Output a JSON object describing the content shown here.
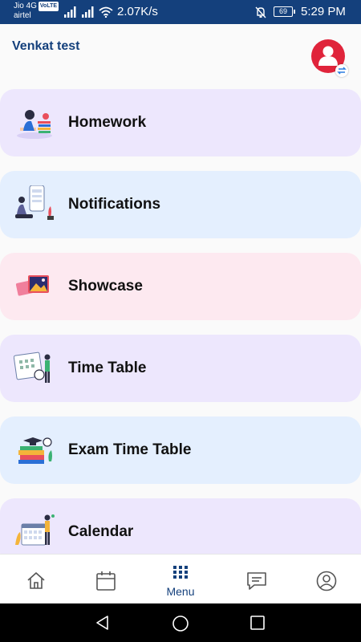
{
  "status_bar": {
    "carrier_line1": "Jio 4G",
    "volte_badge": "VoLTE",
    "carrier_line2": "airtel",
    "network_speed": "2.07K/s",
    "battery_level": "69",
    "time": "5:29 PM"
  },
  "header": {
    "title": "Venkat test"
  },
  "menu_items": [
    {
      "label": "Homework",
      "icon": "homework-icon"
    },
    {
      "label": "Notifications",
      "icon": "notifications-icon"
    },
    {
      "label": "Showcase",
      "icon": "showcase-icon"
    },
    {
      "label": "Time Table",
      "icon": "timetable-icon"
    },
    {
      "label": "Exam Time Table",
      "icon": "exam-timetable-icon"
    },
    {
      "label": "Calendar",
      "icon": "calendar-icon"
    }
  ],
  "bottom_nav": {
    "items": [
      {
        "name": "home",
        "icon": "home-icon"
      },
      {
        "name": "calendar",
        "icon": "calendar-icon"
      },
      {
        "name": "menu",
        "icon": "grid-icon",
        "label": "Menu",
        "active": true
      },
      {
        "name": "messages",
        "icon": "chat-icon"
      },
      {
        "name": "profile",
        "icon": "profile-icon"
      }
    ]
  },
  "colors": {
    "primary": "#14407c",
    "avatar_bg": "#e0243b",
    "card_purple": "#ede7fd",
    "card_blue": "#e4effe",
    "card_pink": "#fde9f0"
  }
}
